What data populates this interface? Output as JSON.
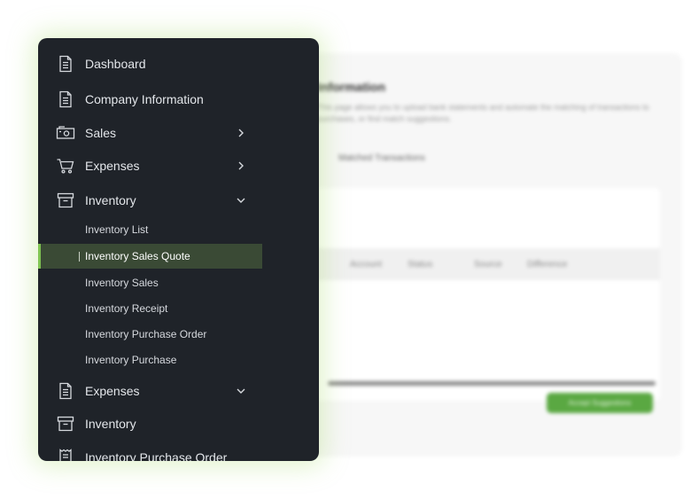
{
  "background": {
    "title": "Information",
    "description": "This page allows you to upload bank statements and automate the matching of transactions to purchases, or find match suggestions.",
    "tab": "Matched Transactions",
    "table_headers": [
      "Account",
      "Status",
      "Source",
      "Difference"
    ],
    "button_label": "Accept Suggestions",
    "accent_color": "#5aa842"
  },
  "sidebar": {
    "items": [
      {
        "label": "Dashboard",
        "icon": "document-icon"
      },
      {
        "label": "Company Information",
        "icon": "document-icon"
      },
      {
        "label": "Sales",
        "icon": "cash-icon",
        "chevron": "chevron-right-icon"
      },
      {
        "label": "Expenses",
        "icon": "cart-icon",
        "chevron": "chevron-right-icon"
      },
      {
        "label": "Inventory",
        "icon": "archive-box-icon",
        "chevron": "chevron-down-icon"
      }
    ],
    "inventory_subitems": [
      {
        "label": "Inventory List"
      },
      {
        "label": "Inventory Sales Quote",
        "active": true
      },
      {
        "label": "Inventory Sales"
      },
      {
        "label": "Inventory Receipt"
      },
      {
        "label": "Inventory Purchase Order"
      },
      {
        "label": "Inventory Purchase"
      }
    ],
    "lower_items": [
      {
        "label": "Expenses",
        "icon": "document-icon",
        "chevron": "chevron-down-icon"
      },
      {
        "label": "Inventory",
        "icon": "archive-box-icon"
      },
      {
        "label": "Inventory Purchase Order",
        "icon": "receipt-icon"
      }
    ],
    "active_color": "#7fc452"
  }
}
